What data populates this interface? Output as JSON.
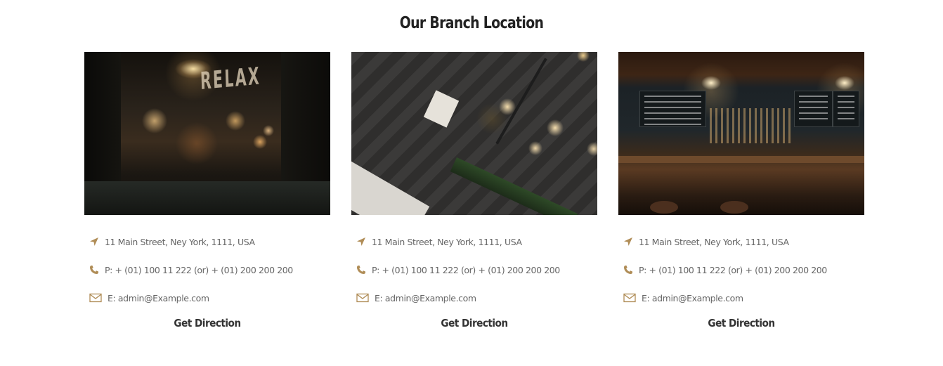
{
  "section": {
    "title": "Our Branch Location"
  },
  "colors": {
    "accent": "#b08d57",
    "text": "#666666",
    "heading": "#222222"
  },
  "branches": [
    {
      "image_icon": "cafe-window-photo",
      "address": "11 Main Street, Ney York, 1111, USA",
      "phone": "P: + (01) 100 11 222 (or) + (01) 200 200 200",
      "email": "E: admin@Example.com",
      "button": "Get Direction"
    },
    {
      "image_icon": "cafe-overhead-photo",
      "address": "11 Main Street, Ney York, 1111, USA",
      "phone": "P: + (01) 100 11 222 (or) + (01) 200 200 200",
      "email": "E: admin@Example.com",
      "button": "Get Direction"
    },
    {
      "image_icon": "bar-interior-photo",
      "address": "11 Main Street, Ney York, 1111, USA",
      "phone": "P: + (01) 100 11 222 (or) + (01) 200 200 200",
      "email": "E: admin@Example.com",
      "button": "Get Direction"
    }
  ],
  "photo_lettering": "RELAX"
}
